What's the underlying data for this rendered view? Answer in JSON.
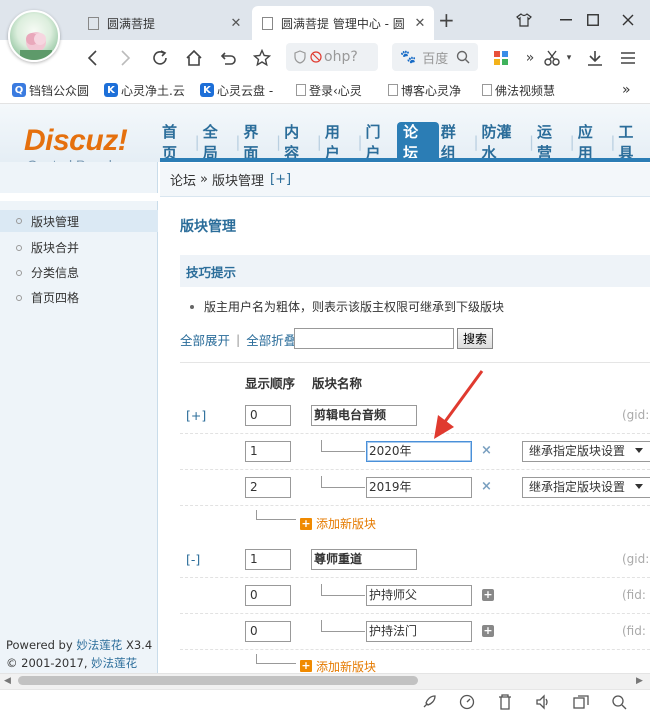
{
  "browser": {
    "tabs": [
      {
        "title": "圆满菩提"
      },
      {
        "title": "圆满菩提 管理中心 - 圆"
      }
    ],
    "url_fragment": "ohp?",
    "search_placeholder": "百度",
    "bookmarks": [
      {
        "label": "铛铛公众圆",
        "icon_color": "#3a7be0",
        "icon_char": "Q"
      },
      {
        "label": "心灵净土.云",
        "icon_color": "#1d6fd8",
        "icon_char": "K"
      },
      {
        "label": "心灵云盘 -",
        "icon_color": "#1d6fd8",
        "icon_char": "K"
      },
      {
        "label": "登录‹心灵",
        "icon_color": "#999999",
        "icon_char": ""
      },
      {
        "label": "博客心灵净",
        "icon_color": "#999999",
        "icon_char": ""
      },
      {
        "label": "佛法视频慧",
        "icon_color": "#999999",
        "icon_char": ""
      }
    ],
    "bookmarks_more": "»"
  },
  "header": {
    "logo": "Discuz!",
    "subtitle": "Control Panel",
    "nav": [
      "首页",
      "全局",
      "界面",
      "内容",
      "用户",
      "门户",
      "论坛",
      "群组",
      "防灌水",
      "运营",
      "应用",
      "工具"
    ],
    "active_nav": "论坛"
  },
  "breadcrumb": {
    "root": "论坛",
    "sep": "»",
    "current": "版块管理",
    "add": "[+]"
  },
  "sidebar": {
    "items": [
      {
        "label": "版块管理",
        "active": true
      },
      {
        "label": "版块合并",
        "active": false
      },
      {
        "label": "分类信息",
        "active": false
      },
      {
        "label": "首页四格",
        "active": false
      }
    ],
    "powered_prefix": "Powered by ",
    "powered_name": "妙法莲花",
    "version": " X3.4",
    "copyright_prefix": "© 2001-2017, ",
    "copyright_name": "妙法莲花"
  },
  "main": {
    "title": "版块管理",
    "tip_title": "技巧提示",
    "tip_text": "版主用户名为粗体，则表示该版主权限可继承到下级版块",
    "expand_all": "全部展开",
    "divider": "|",
    "collapse_all": "全部折叠",
    "search_button": "搜索",
    "col_order": "显示顺序",
    "col_name": "版块名称",
    "groups": [
      {
        "toggle": "[+]",
        "order": "0",
        "name": "剪辑电台音频",
        "id_label": "(gid:",
        "forums": [
          {
            "order": "1",
            "name": "2020年",
            "inherit": "继承指定版块设置"
          },
          {
            "order": "2",
            "name": "2019年",
            "inherit": "继承指定版块设置"
          }
        ],
        "add_label": "添加新版块"
      },
      {
        "toggle": "[-]",
        "order": "1",
        "name": "尊师重道",
        "id_label": "(gid:",
        "forums": [
          {
            "order": "0",
            "name": "护持师父",
            "id_label": "(fid:"
          },
          {
            "order": "0",
            "name": "护持法门",
            "id_label": "(fid:"
          }
        ],
        "add_label": "添加新版块"
      }
    ],
    "delete_symbol": "×",
    "plus_symbol": "+"
  },
  "colors": {
    "accent": "#2b7db5",
    "link": "#2b6d9a",
    "logo": "#e5700e",
    "add": "#f08a00",
    "arrow": "#e03a2f"
  }
}
